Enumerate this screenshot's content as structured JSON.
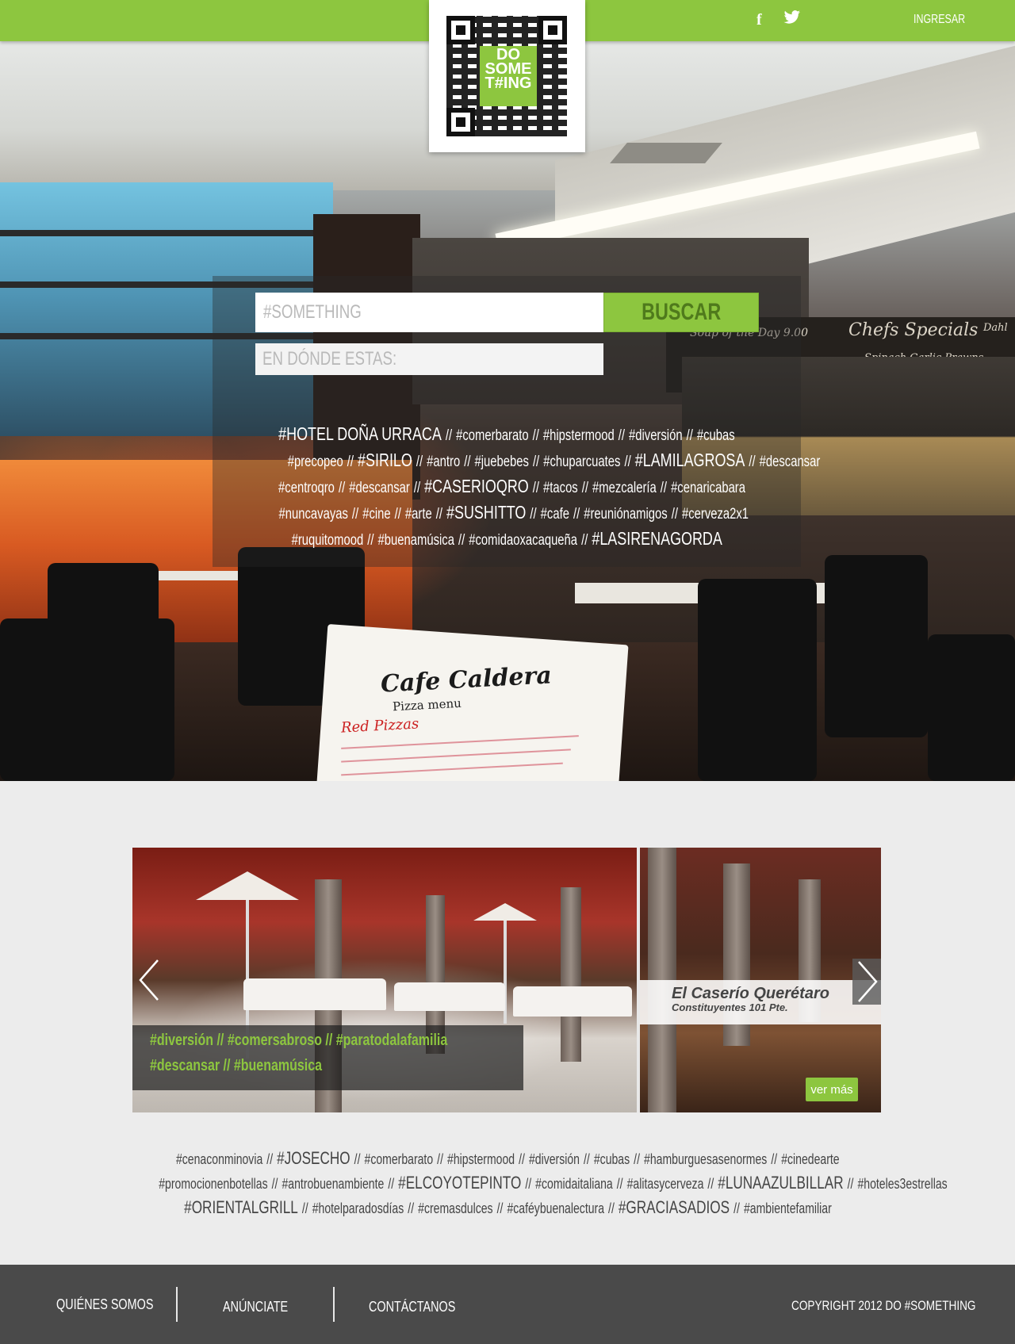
{
  "header": {
    "login_label": "INGRESAR",
    "social": [
      {
        "name": "facebook-icon",
        "glyph": "f"
      },
      {
        "name": "twitter-icon",
        "glyph": "🐦"
      }
    ],
    "logo": {
      "lines": [
        "DO",
        "SOME",
        "T#ING"
      ]
    }
  },
  "search": {
    "placeholder": "#SOMETHING",
    "button_label": "BUSCAR",
    "where_placeholder": "EN DÓNDE ESTAS:"
  },
  "hero_photo": {
    "chalk_board": [
      "Chefs Specials",
      "Soup of the Day 9.00",
      "Spinach Garlic Prawns",
      "Dahl"
    ],
    "menu_card_title": "Cafe Caldera",
    "menu_card_sub": "Pizza menu",
    "menu_card_red": "Red Pizzas"
  },
  "hero_tags": [
    [
      {
        "t": "#HOTEL DOÑA URRACA",
        "big": true
      },
      {
        "t": "#comerbarato"
      },
      {
        "t": "#hipstermood"
      },
      {
        "t": "#diversión"
      },
      {
        "t": "#cubas"
      }
    ],
    [
      {
        "t": "#precopeo"
      },
      {
        "t": "#SIRILO",
        "big": true
      },
      {
        "t": "#antro"
      },
      {
        "t": "#juebebes"
      },
      {
        "t": "#chuparcuates"
      },
      {
        "t": "#LAMILAGROSA",
        "big": true
      },
      {
        "t": "#descansar"
      }
    ],
    [
      {
        "t": "#centroqro"
      },
      {
        "t": "#descansar"
      },
      {
        "t": "#CASERIOQRO",
        "big": true
      },
      {
        "t": "#tacos"
      },
      {
        "t": "#mezcalería"
      },
      {
        "t": "#cenaricabara"
      }
    ],
    [
      {
        "t": "#nuncavayas"
      },
      {
        "t": "#cine"
      },
      {
        "t": "#arte"
      },
      {
        "t": "#SUSHITTO",
        "big": true
      },
      {
        "t": "#cafe"
      },
      {
        "t": "#reuniónamigos"
      },
      {
        "t": "#cerveza2x1"
      }
    ],
    [
      {
        "t": "#ruquitomood"
      },
      {
        "t": "#buenamúsica"
      },
      {
        "t": "#comidaoxacaqueña"
      },
      {
        "t": "#LASIRENAGORDA",
        "big": true
      }
    ]
  ],
  "featured": {
    "title": "El Caserío Querétaro",
    "address": "Constituyentes 101 Pte.",
    "tags_rows": [
      "#diversión // #comersabroso // #paratodalafamilia",
      "#descansar  // #buenamúsica"
    ],
    "more_label": "ver más"
  },
  "bottom_tags": [
    [
      {
        "t": "#cenaconminovia"
      },
      {
        "t": "#JOSECHO",
        "big": true
      },
      {
        "t": "#comerbarato"
      },
      {
        "t": "#hipstermood"
      },
      {
        "t": "#diversión"
      },
      {
        "t": "#cubas"
      },
      {
        "t": "#hamburguesasenormes"
      },
      {
        "t": "#cinedearte"
      }
    ],
    [
      {
        "t": "#promocionenbotellas"
      },
      {
        "t": "#antrobuenambiente"
      },
      {
        "t": "#ELCOYOTEPINTO",
        "big": true
      },
      {
        "t": "#comidaitaliana"
      },
      {
        "t": "#alitasycerveza"
      },
      {
        "t": "#LUNAAZULBILLAR",
        "big": true
      },
      {
        "t": "#hoteles3estrellas"
      }
    ],
    [
      {
        "t": "#ORIENTALGRILL",
        "big": true
      },
      {
        "t": "#hotelparadosdías"
      },
      {
        "t": "#cremasdulces"
      },
      {
        "t": "#caféybuenalectura"
      },
      {
        "t": "#GRACIASADIOS",
        "big": true
      },
      {
        "t": "#ambientefamiliar"
      }
    ]
  ],
  "footer": {
    "links": [
      "QUIÉNES SOMOS",
      "ANÚNCIATE",
      "CONTÁCTANOS"
    ],
    "copyright": "COPYRIGHT 2012  DO #SOMETHING"
  },
  "colors": {
    "brand_green": "#8dc63f",
    "footer": "#4a4a4a",
    "page_bg": "#ececec"
  },
  "separator": "//"
}
